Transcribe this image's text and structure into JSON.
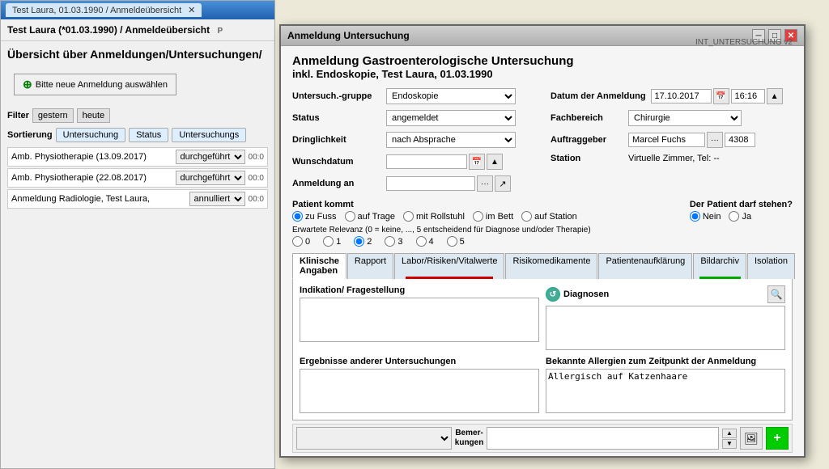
{
  "bg_window": {
    "title_tab": "Test Laura, 01.03.1990 / Anmeldeübersicht",
    "subtitle": "Test Laura (*01.03.1990) / Anmeldeübersicht",
    "heading": "Übersicht über Anmeldungen/Untersuchungen/",
    "btn_new": "Bitte neue Anmeldung auswählen",
    "filter_label": "Filter",
    "filter_gestern": "gestern",
    "filter_heute": "heute",
    "sort_label": "Sortierung",
    "sort_btn1": "Untersuchung",
    "sort_btn2": "Status",
    "sort_btn3": "Untersuchungs",
    "list_items": [
      {
        "name": "Amb. Physiotherapie (13.09.2017)",
        "status": "durchgeführt",
        "time": "00:0"
      },
      {
        "name": "Amb. Physiotherapie (22.08.2017)",
        "status": "durchgeführt",
        "time": "00:0"
      },
      {
        "name": "Anmeldung Radiologie, Test Laura,",
        "status": "annulliert",
        "time": "00:0"
      }
    ]
  },
  "modal": {
    "title": "Anmeldung Untersuchung",
    "header_line1": "Anmeldung Gastroenterologische  Untersuchung",
    "header_line2": "inkl. Endoskopie, Test Laura, 01.03.1990",
    "version": "INT_UNTERSUCHUNG v2",
    "form": {
      "untersuchgruppe_label": "Untersuch.-gruppe",
      "untersuchgruppe_value": "Endoskopie",
      "status_label": "Status",
      "status_value": "angemeldet",
      "dringlichkeit_label": "Dringlichkeit",
      "dringlichkeit_value": "nach Absprache",
      "wunschdatum_label": "Wunschdatum",
      "anmeldung_an_label": "Anmeldung an",
      "datum_label": "Datum der Anmeldung",
      "datum_value": "17.10.2017",
      "time_value": "16:16",
      "fachbereich_label": "Fachbereich",
      "fachbereich_value": "Chirurgie",
      "auftraggeber_label": "Auftraggeber",
      "auftraggeber_value": "Marcel Fuchs",
      "auftraggeber_num": "4308",
      "station_label": "Station",
      "station_value": "Virtuelle Zimmer, Tel: --"
    },
    "patient_kommt_label": "Patient kommt",
    "patient_options": [
      "zu Fuss",
      "auf Trage",
      "mit Rollstuhl",
      "im Bett",
      "auf Station"
    ],
    "patient_selected": "zu Fuss",
    "darf_stehen_label": "Der Patient darf stehen?",
    "darf_nein": "Nein",
    "darf_ja": "Ja",
    "relevanz_desc": "Erwartete Relevanz (0 = keine, ..., 5 entscheidend für Diagnose und/oder Therapie)",
    "relevanz_options": [
      "0",
      "1",
      "2",
      "3",
      "4",
      "5"
    ],
    "relevanz_selected": "2",
    "tabs": [
      {
        "label": "Klinische Angaben",
        "active": true,
        "bar": ""
      },
      {
        "label": "Rapport",
        "active": false,
        "bar": ""
      },
      {
        "label": "Labor/Risiken/Vitalwerte",
        "active": false,
        "bar": "red"
      },
      {
        "label": "Risikomedikamente",
        "active": false,
        "bar": ""
      },
      {
        "label": "Patientenaufklärung",
        "active": false,
        "bar": ""
      },
      {
        "label": "Bildarchiv",
        "active": false,
        "bar": "green"
      },
      {
        "label": "Isolation",
        "active": false,
        "bar": ""
      }
    ],
    "tab_content": {
      "indikation_label": "Indikation/ Fragestellung",
      "indikation_value": "",
      "diagnosen_label": "Diagnosen",
      "diagnosen_value": "",
      "ergebnisse_label": "Ergebnisse anderer Untersuchungen",
      "ergebnisse_value": "",
      "allergien_label": "Bekannte Allergien zum Zeitpunkt der Anmeldung",
      "allergien_value": "Allergisch auf Katzenhaare"
    },
    "footer": {
      "bemerkungen_label": "Bemer-\nkungen"
    }
  }
}
